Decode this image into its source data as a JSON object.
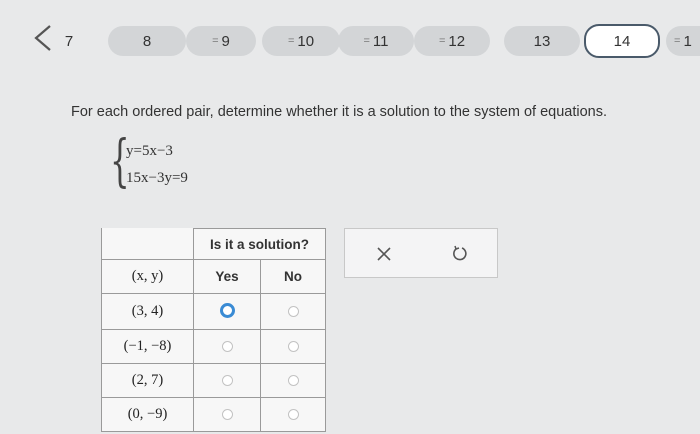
{
  "nav": {
    "items": [
      {
        "label": "7",
        "answered": false,
        "current": false
      },
      {
        "label": "8",
        "answered": false,
        "current": false
      },
      {
        "label": "9",
        "answered": true,
        "current": false
      },
      {
        "label": "10",
        "answered": true,
        "current": false
      },
      {
        "label": "11",
        "answered": true,
        "current": false
      },
      {
        "label": "12",
        "answered": true,
        "current": false
      },
      {
        "label": "13",
        "answered": false,
        "current": false
      },
      {
        "label": "14",
        "answered": false,
        "current": true
      },
      {
        "label": "1",
        "answered": true,
        "current": false
      }
    ],
    "answered_icon": "equals-lines-icon"
  },
  "question": {
    "prompt": "For each ordered pair, determine whether it is a solution to the system of equations.",
    "equations": [
      "y=5x−3",
      "15x−3y=9"
    ]
  },
  "table": {
    "header_group": "Is it a solution?",
    "col_pair": "(x, y)",
    "col_yes": "Yes",
    "col_no": "No",
    "rows": [
      {
        "pair": "(3, 4)",
        "selected": "yes"
      },
      {
        "pair": "(−1, −8)",
        "selected": null
      },
      {
        "pair": "(2, 7)",
        "selected": null
      },
      {
        "pair": "(0, −9)",
        "selected": null
      }
    ]
  },
  "actions": {
    "clear_icon": "x-icon",
    "undo_icon": "undo-icon"
  },
  "colors": {
    "selected_radio": "#3a8bd4",
    "current_border": "#4a5a6a"
  }
}
